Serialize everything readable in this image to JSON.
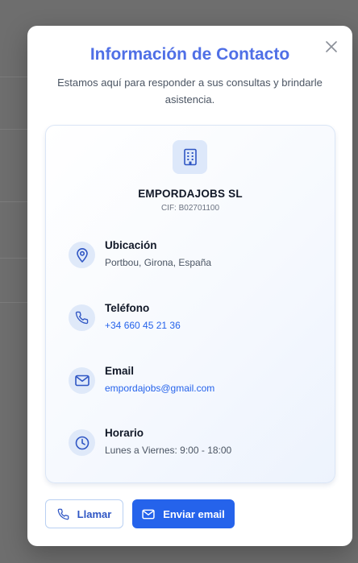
{
  "modal": {
    "title": "Información de Contacto",
    "subtitle": "Estamos aquí para responder a sus consultas y brindarle asistencia.",
    "close_icon": "close-icon"
  },
  "company": {
    "icon": "building-icon",
    "name": "EMPORDAJOBS SL",
    "cif": "CIF: B02701100"
  },
  "contact_items": [
    {
      "icon": "map-pin-icon",
      "label": "Ubicación",
      "value": "Portbou, Girona, España"
    },
    {
      "icon": "phone-icon",
      "label": "Teléfono",
      "value": "+34 660 45 21 36"
    },
    {
      "icon": "mail-icon",
      "label": "Email",
      "value": "empordajobs@gmail.com"
    },
    {
      "icon": "clock-icon",
      "label": "Horario",
      "value": "Lunes a Viernes: 9:00 - 18:00"
    }
  ],
  "actions": {
    "call_label": "Llamar",
    "email_label": "Enviar email"
  },
  "colors": {
    "accent": "#2563eb",
    "title": "#4f6fe6",
    "overlay": "#6e6e6e"
  }
}
